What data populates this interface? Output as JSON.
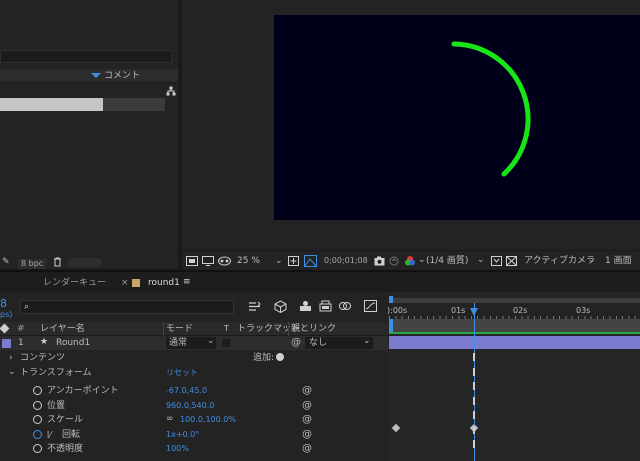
{
  "project": {
    "comment_label": "コメント",
    "bpc": "8 bpc"
  },
  "viewer": {
    "zoom": "25 %",
    "timecode": "0;00;01;08",
    "resolution": "(1/4 画質)",
    "camera": "アクティブカメラ",
    "views": "1 画面",
    "background_color": "#00001a",
    "arc_color": "#18e418"
  },
  "tabs": {
    "render_queue": "レンダーキュー",
    "comp_name": "round1",
    "close_glyph": "×",
    "menu_glyph": "≡"
  },
  "timeline": {
    "frame_digit": "8",
    "fps_fragment": "ps)",
    "search_placeholder": "",
    "columns": {
      "hash": "#",
      "layer_name": "レイヤー名",
      "mode": "モード",
      "t": "T",
      "track_matte": "トラックマット",
      "parent": "親とリンク"
    },
    "ruler": [
      "):00s",
      "01s",
      "02s",
      "03s"
    ],
    "layer": {
      "number": "1",
      "name": "Round1",
      "mode": "通常",
      "parent": "なし",
      "bar_color": "#7b7bd0"
    },
    "contents": {
      "label": "コンテンツ",
      "add": "追加:"
    },
    "transform": {
      "label": "トランスフォーム",
      "reset": "リセット"
    },
    "properties": [
      {
        "label": "アンカーポイント",
        "value": "-67.0,45.0"
      },
      {
        "label": "位置",
        "value": "960.0,540.0"
      },
      {
        "label": "スケール",
        "value": "100.0,100.0%"
      },
      {
        "label": "回転",
        "value": "1x+0.0°"
      },
      {
        "label": "不透明度",
        "value": "100%"
      }
    ]
  }
}
